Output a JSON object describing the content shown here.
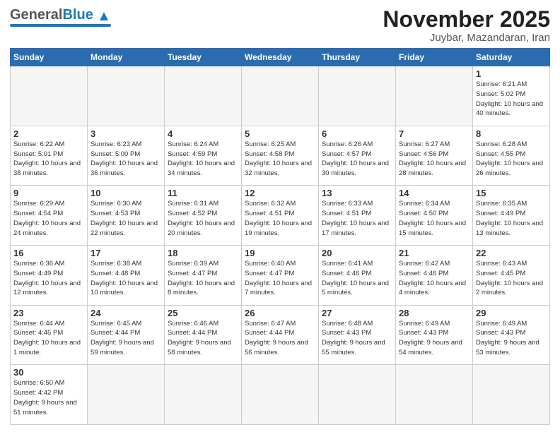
{
  "header": {
    "logo_general": "General",
    "logo_blue": "Blue",
    "title": "November 2025",
    "subtitle": "Juybar, Mazandaran, Iran"
  },
  "weekdays": [
    "Sunday",
    "Monday",
    "Tuesday",
    "Wednesday",
    "Thursday",
    "Friday",
    "Saturday"
  ],
  "weeks": [
    [
      {
        "day": "",
        "info": ""
      },
      {
        "day": "",
        "info": ""
      },
      {
        "day": "",
        "info": ""
      },
      {
        "day": "",
        "info": ""
      },
      {
        "day": "",
        "info": ""
      },
      {
        "day": "",
        "info": ""
      },
      {
        "day": "1",
        "info": "Sunrise: 6:21 AM\nSunset: 5:02 PM\nDaylight: 10 hours\nand 40 minutes."
      }
    ],
    [
      {
        "day": "2",
        "info": "Sunrise: 6:22 AM\nSunset: 5:01 PM\nDaylight: 10 hours\nand 38 minutes."
      },
      {
        "day": "3",
        "info": "Sunrise: 6:23 AM\nSunset: 5:00 PM\nDaylight: 10 hours\nand 36 minutes."
      },
      {
        "day": "4",
        "info": "Sunrise: 6:24 AM\nSunset: 4:59 PM\nDaylight: 10 hours\nand 34 minutes."
      },
      {
        "day": "5",
        "info": "Sunrise: 6:25 AM\nSunset: 4:58 PM\nDaylight: 10 hours\nand 32 minutes."
      },
      {
        "day": "6",
        "info": "Sunrise: 6:26 AM\nSunset: 4:57 PM\nDaylight: 10 hours\nand 30 minutes."
      },
      {
        "day": "7",
        "info": "Sunrise: 6:27 AM\nSunset: 4:56 PM\nDaylight: 10 hours\nand 28 minutes."
      },
      {
        "day": "8",
        "info": "Sunrise: 6:28 AM\nSunset: 4:55 PM\nDaylight: 10 hours\nand 26 minutes."
      }
    ],
    [
      {
        "day": "9",
        "info": "Sunrise: 6:29 AM\nSunset: 4:54 PM\nDaylight: 10 hours\nand 24 minutes."
      },
      {
        "day": "10",
        "info": "Sunrise: 6:30 AM\nSunset: 4:53 PM\nDaylight: 10 hours\nand 22 minutes."
      },
      {
        "day": "11",
        "info": "Sunrise: 6:31 AM\nSunset: 4:52 PM\nDaylight: 10 hours\nand 20 minutes."
      },
      {
        "day": "12",
        "info": "Sunrise: 6:32 AM\nSunset: 4:51 PM\nDaylight: 10 hours\nand 19 minutes."
      },
      {
        "day": "13",
        "info": "Sunrise: 6:33 AM\nSunset: 4:51 PM\nDaylight: 10 hours\nand 17 minutes."
      },
      {
        "day": "14",
        "info": "Sunrise: 6:34 AM\nSunset: 4:50 PM\nDaylight: 10 hours\nand 15 minutes."
      },
      {
        "day": "15",
        "info": "Sunrise: 6:35 AM\nSunset: 4:49 PM\nDaylight: 10 hours\nand 13 minutes."
      }
    ],
    [
      {
        "day": "16",
        "info": "Sunrise: 6:36 AM\nSunset: 4:49 PM\nDaylight: 10 hours\nand 12 minutes."
      },
      {
        "day": "17",
        "info": "Sunrise: 6:38 AM\nSunset: 4:48 PM\nDaylight: 10 hours\nand 10 minutes."
      },
      {
        "day": "18",
        "info": "Sunrise: 6:39 AM\nSunset: 4:47 PM\nDaylight: 10 hours\nand 8 minutes."
      },
      {
        "day": "19",
        "info": "Sunrise: 6:40 AM\nSunset: 4:47 PM\nDaylight: 10 hours\nand 7 minutes."
      },
      {
        "day": "20",
        "info": "Sunrise: 6:41 AM\nSunset: 4:46 PM\nDaylight: 10 hours\nand 5 minutes."
      },
      {
        "day": "21",
        "info": "Sunrise: 6:42 AM\nSunset: 4:46 PM\nDaylight: 10 hours\nand 4 minutes."
      },
      {
        "day": "22",
        "info": "Sunrise: 6:43 AM\nSunset: 4:45 PM\nDaylight: 10 hours\nand 2 minutes."
      }
    ],
    [
      {
        "day": "23",
        "info": "Sunrise: 6:44 AM\nSunset: 4:45 PM\nDaylight: 10 hours\nand 1 minute."
      },
      {
        "day": "24",
        "info": "Sunrise: 6:45 AM\nSunset: 4:44 PM\nDaylight: 9 hours\nand 59 minutes."
      },
      {
        "day": "25",
        "info": "Sunrise: 6:46 AM\nSunset: 4:44 PM\nDaylight: 9 hours\nand 58 minutes."
      },
      {
        "day": "26",
        "info": "Sunrise: 6:47 AM\nSunset: 4:44 PM\nDaylight: 9 hours\nand 56 minutes."
      },
      {
        "day": "27",
        "info": "Sunrise: 6:48 AM\nSunset: 4:43 PM\nDaylight: 9 hours\nand 55 minutes."
      },
      {
        "day": "28",
        "info": "Sunrise: 6:49 AM\nSunset: 4:43 PM\nDaylight: 9 hours\nand 54 minutes."
      },
      {
        "day": "29",
        "info": "Sunrise: 6:49 AM\nSunset: 4:43 PM\nDaylight: 9 hours\nand 53 minutes."
      }
    ],
    [
      {
        "day": "30",
        "info": "Sunrise: 6:50 AM\nSunset: 4:42 PM\nDaylight: 9 hours\nand 51 minutes."
      },
      {
        "day": "",
        "info": ""
      },
      {
        "day": "",
        "info": ""
      },
      {
        "day": "",
        "info": ""
      },
      {
        "day": "",
        "info": ""
      },
      {
        "day": "",
        "info": ""
      },
      {
        "day": "",
        "info": ""
      }
    ]
  ]
}
